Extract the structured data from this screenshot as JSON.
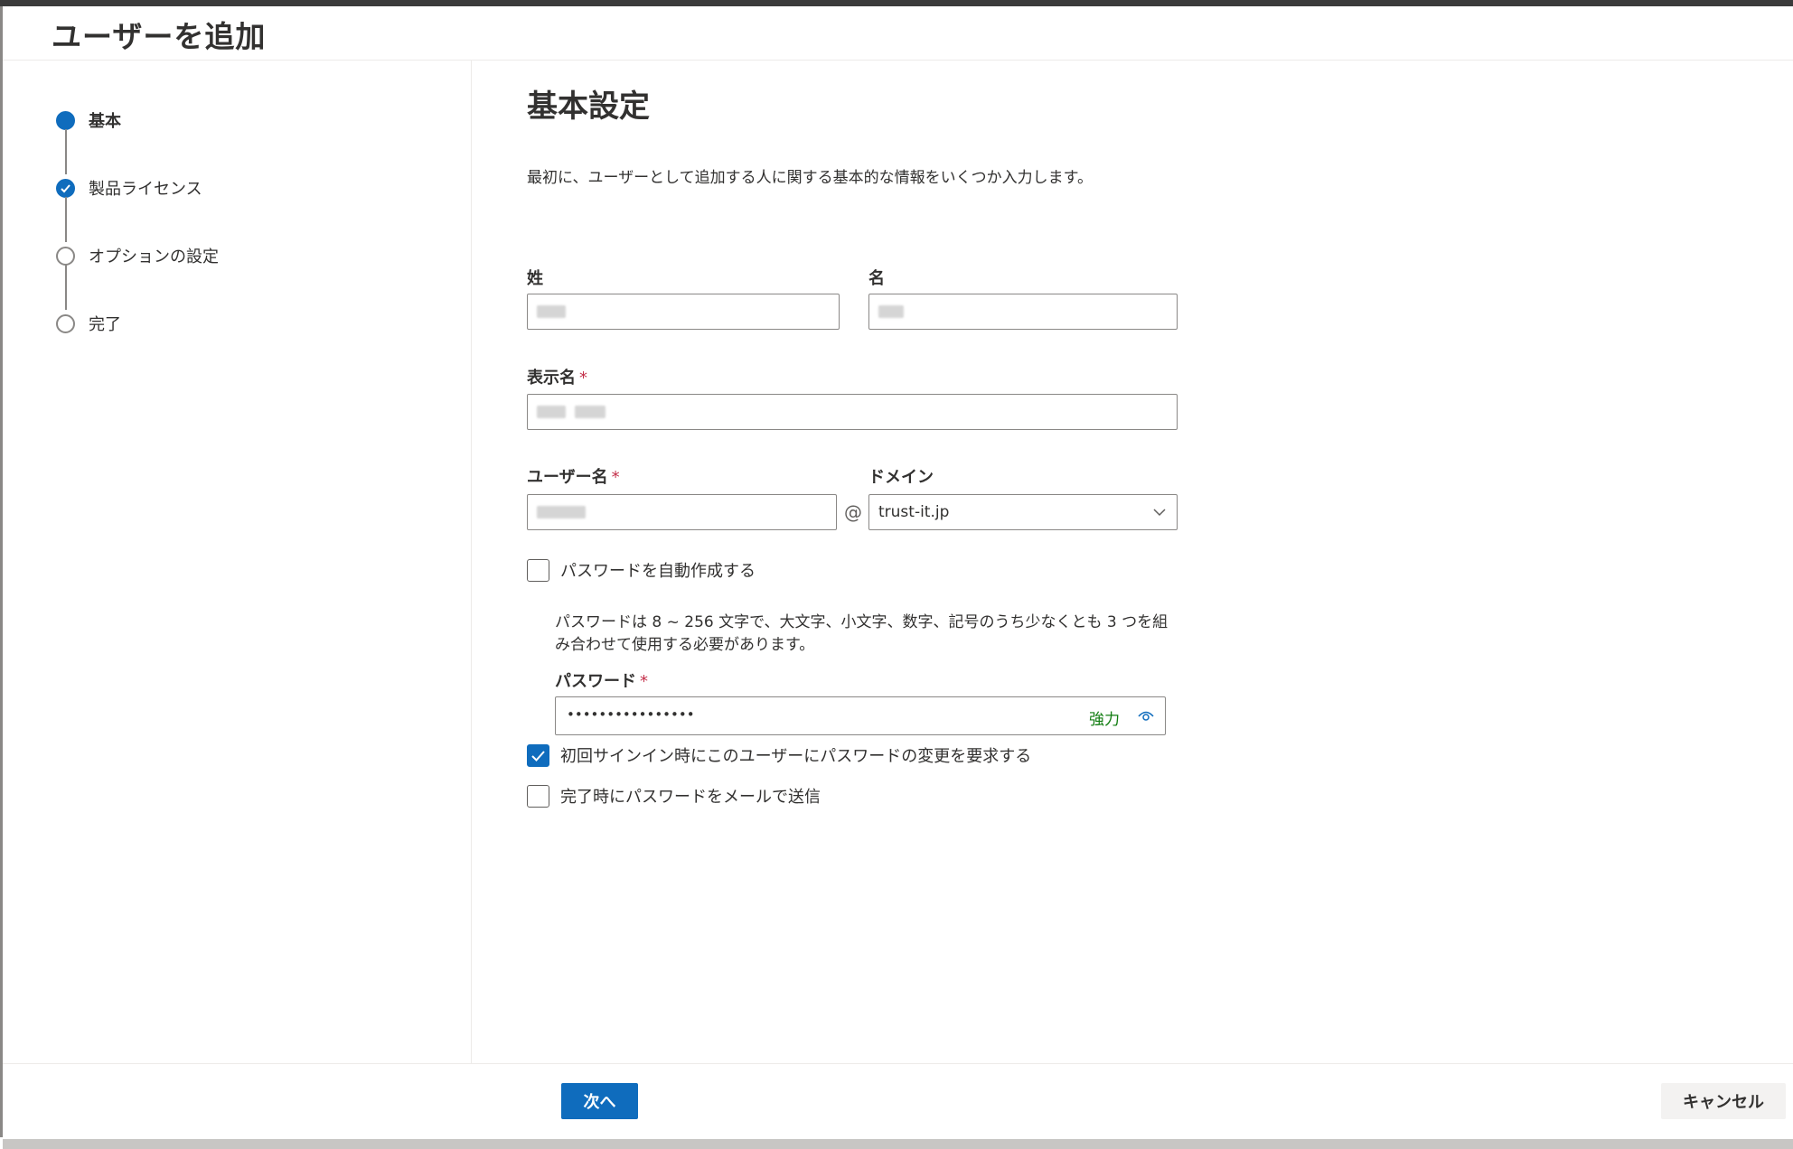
{
  "panel": {
    "title": "ユーザーを追加"
  },
  "steps": [
    {
      "label": "基本",
      "state": "current"
    },
    {
      "label": "製品ライセンス",
      "state": "completed"
    },
    {
      "label": "オプションの設定",
      "state": "pending"
    },
    {
      "label": "完了",
      "state": "pending"
    }
  ],
  "section": {
    "title": "基本設定",
    "description": "最初に、ユーザーとして追加する人に関する基本的な情報をいくつか入力します。"
  },
  "fields": {
    "last_name_label": "姓",
    "first_name_label": "名",
    "display_name_label": "表示名",
    "username_label": "ユーザー名",
    "domain_label": "ドメイン",
    "required_marker": "*",
    "at_symbol": "@",
    "domain_value": "trust-it.jp"
  },
  "password": {
    "auto_create_label": "パスワードを自動作成する",
    "auto_create_checked": false,
    "hint": "パスワードは 8 ~ 256 文字で、大文字、小文字、数字、記号のうち少なくとも 3 つを組み合わせて使用する必要があります。",
    "label": "パスワード",
    "masked_value": "••••••••••••••••",
    "strength": "強力",
    "require_change_label": "初回サインイン時にこのユーザーにパスワードの変更を要求する",
    "require_change_checked": true,
    "email_label": "完了時にパスワードをメールで送信",
    "email_checked": false
  },
  "footer": {
    "next_label": "次へ",
    "cancel_label": "キャンセル"
  },
  "colors": {
    "accent": "#0f6cbd",
    "strength_green": "#107c10",
    "required_red": "#c4314b"
  }
}
